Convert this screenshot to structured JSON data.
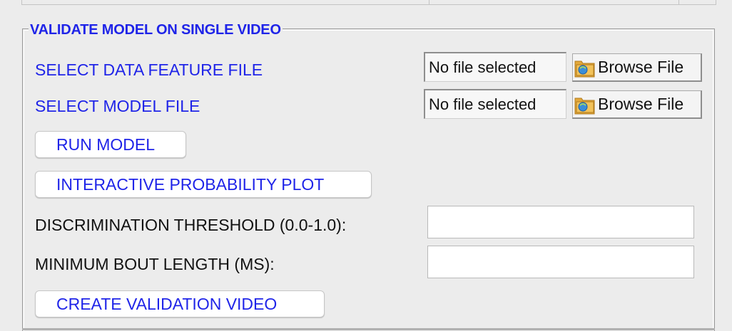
{
  "panel": {
    "title": "VALIDATE MODEL ON SINGLE VIDEO"
  },
  "data_feature": {
    "label": "SELECT DATA FEATURE FILE",
    "file_value": "No file selected",
    "browse_label": "Browse File"
  },
  "model_file": {
    "label": "SELECT MODEL FILE",
    "file_value": "No file selected",
    "browse_label": "Browse File"
  },
  "buttons": {
    "run_model": "RUN MODEL",
    "interactive_plot": "INTERACTIVE PROBABILITY PLOT",
    "create_video": "CREATE VALIDATION VIDEO"
  },
  "threshold": {
    "label": "DISCRIMINATION THRESHOLD (0.0-1.0):",
    "value": ""
  },
  "min_bout": {
    "label": "MINIMUM BOUT LENGTH (MS):",
    "value": ""
  },
  "icons": {
    "browse": "folder-icon"
  },
  "colors": {
    "label_blue": "#1f24e8",
    "background": "#ececec"
  }
}
